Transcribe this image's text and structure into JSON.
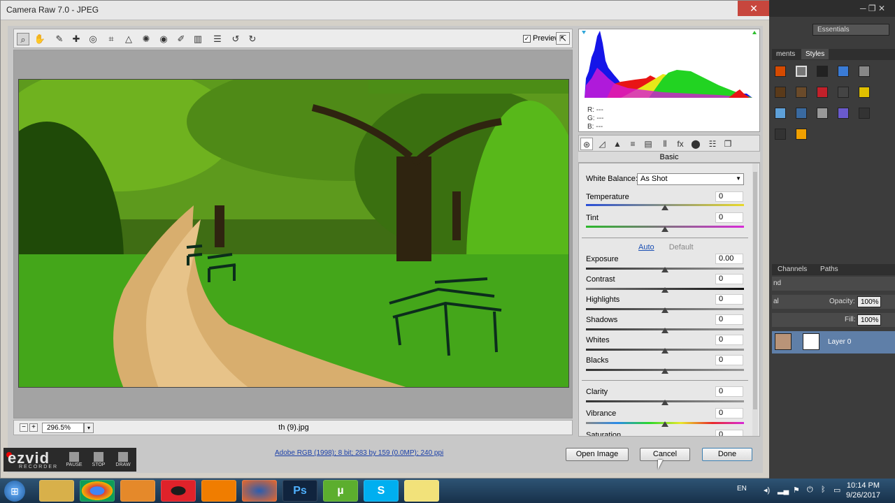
{
  "window": {
    "title": "Camera Raw 7.0 - JPEG",
    "close_glyph": "✕"
  },
  "toolbar": {
    "tools": [
      "zoom-icon",
      "hand-icon",
      "white-balance-icon",
      "color-sampler-icon",
      "target-adjust-icon",
      "crop-icon",
      "straighten-icon",
      "spot-removal-icon",
      "red-eye-icon",
      "adjustment-brush-icon",
      "graduated-filter-icon",
      "preferences-icon",
      "rotate-ccw-icon",
      "rotate-cw-icon"
    ],
    "glyphs": [
      "⌕",
      "✋",
      "✎",
      "✚",
      "◎",
      "⌗",
      "△",
      "✺",
      "◉",
      "✐",
      "▥",
      "☰",
      "↺",
      "↻"
    ],
    "preview_label": "Preview",
    "preview_checked": "✓",
    "fullscreen_glyph": "⇱"
  },
  "status": {
    "zoom_out": "−",
    "zoom_in": "+",
    "zoom_value": "296.5%",
    "zoom_dropdown": "▾",
    "filename": "th (9).jpg"
  },
  "histogram": {
    "r_label": "R:",
    "r": "---",
    "g_label": "G:",
    "g": "---",
    "b_label": "B:",
    "b": "---"
  },
  "panel_tabs": {
    "icons": [
      "basic-icon",
      "tone-curve-icon",
      "detail-icon",
      "hsl-icon",
      "split-toning-icon",
      "lens-icon",
      "fx-icon",
      "camera-calibration-icon",
      "presets-icon",
      "snapshots-icon"
    ],
    "glyphs": [
      "⊛",
      "◿",
      "▲",
      "≡",
      "▤",
      "⦀",
      "fx",
      "⬤",
      "☷",
      "❐"
    ]
  },
  "panel": {
    "title": "Basic",
    "white_balance_label": "White Balance:",
    "white_balance_value": "As Shot",
    "temperature_label": "Temperature",
    "temperature": "0",
    "tint_label": "Tint",
    "tint": "0",
    "auto_label": "Auto",
    "default_label": "Default",
    "exposure_label": "Exposure",
    "exposure": "0.00",
    "contrast_label": "Contrast",
    "contrast": "0",
    "highlights_label": "Highlights",
    "highlights": "0",
    "shadows_label": "Shadows",
    "shadows": "0",
    "whites_label": "Whites",
    "whites": "0",
    "blacks_label": "Blacks",
    "blacks": "0",
    "clarity_label": "Clarity",
    "clarity": "0",
    "vibrance_label": "Vibrance",
    "vibrance": "0",
    "saturation_label": "Saturation",
    "saturation": "0"
  },
  "footer": {
    "info_link": "Adobe RGB (1998); 8 bit; 283 by 159 (0.0MP); 240 ppi",
    "open_image": "Open Image",
    "cancel": "Cancel",
    "done": "Done"
  },
  "ezvid": {
    "logo": "ezvid",
    "sub": "RECORDER",
    "pause": "PAUSE",
    "stop": "STOP",
    "draw": "DRAW"
  },
  "photoshop": {
    "window_controls": "─   ❐   ✕",
    "workspace": "Essentials",
    "tab_prev": "ments",
    "tab_styles": "Styles",
    "tab_channels": "Channels",
    "tab_paths": "Paths",
    "blend_fragment": "nd",
    "mode_fragment": "al",
    "opacity_label": "Opacity:",
    "opacity": "100%",
    "fill_label": "Fill:",
    "fill": "100%",
    "layer_name": "Layer 0"
  },
  "taskbar": {
    "apps": [
      "windows-start",
      "file-explorer",
      "chrome",
      "media-player",
      "opera",
      "vlc",
      "firefox",
      "photoshop",
      "utorrent",
      "skype",
      "notepad"
    ],
    "labels": [
      "",
      "",
      "",
      "",
      "",
      "",
      "",
      "Ps",
      "µ",
      "S",
      ""
    ],
    "lang": "EN",
    "time": "10:14 PM",
    "date": "9/26/2017"
  }
}
